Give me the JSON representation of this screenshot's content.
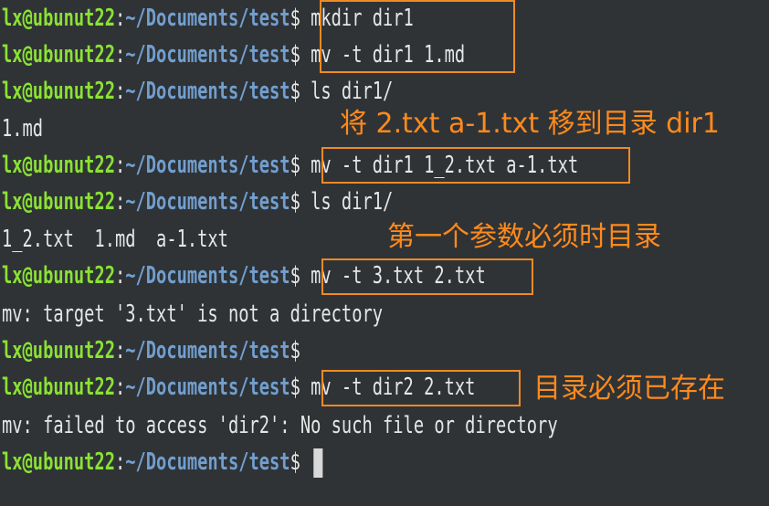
{
  "prompt": {
    "user_host": "lx@ubunut22",
    "path": "~/Documents/test",
    "separator": ":",
    "symbol": "$"
  },
  "lines": [
    {
      "type": "prompt",
      "cmd": " mkdir dir1"
    },
    {
      "type": "prompt",
      "cmd": " mv -t dir1 1.md"
    },
    {
      "type": "prompt",
      "cmd": " ls dir1/"
    },
    {
      "type": "output",
      "text": "1.md"
    },
    {
      "type": "prompt",
      "cmd": " mv -t dir1 1_2.txt a-1.txt"
    },
    {
      "type": "prompt",
      "cmd": " ls dir1/"
    },
    {
      "type": "output",
      "text": "1_2.txt  1.md  a-1.txt"
    },
    {
      "type": "prompt",
      "cmd": " mv -t 3.txt 2.txt"
    },
    {
      "type": "output",
      "text": "mv: target '3.txt' is not a directory"
    },
    {
      "type": "prompt",
      "cmd": ""
    },
    {
      "type": "prompt",
      "cmd": " mv -t dir2 2.txt"
    },
    {
      "type": "output",
      "text": "mv: failed to access 'dir2': No such file or directory"
    },
    {
      "type": "prompt",
      "cmd": " "
    }
  ],
  "annotations": {
    "note1": "将 2.txt a-1.txt 移到目录 dir1",
    "note2": "第一个参数必须时目录",
    "note3": "目录必须已存在"
  },
  "colors": {
    "background": "#2f3336",
    "user": "#8ae234",
    "path": "#729fcf",
    "annotation": "#f08a24"
  }
}
